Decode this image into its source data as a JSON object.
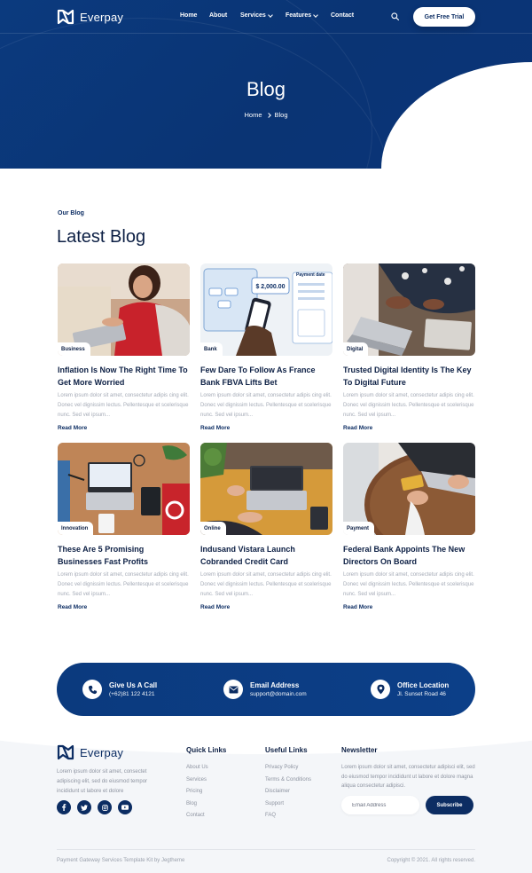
{
  "brand": {
    "name": "Everpay"
  },
  "nav": {
    "items": [
      {
        "label": "Home"
      },
      {
        "label": "About"
      },
      {
        "label": "Services"
      },
      {
        "label": "Features"
      },
      {
        "label": "Contact"
      }
    ],
    "cta_label": "Get Free Trial",
    "search_icon": "search-icon"
  },
  "hero": {
    "title": "Blog",
    "breadcrumb": [
      "Home",
      "Blog"
    ]
  },
  "blog": {
    "eyebrow": "Our Blog",
    "title": "Latest Blog",
    "posts": [
      {
        "category": "Business",
        "title": "Inflation Is Now The Right Time To Get More Worried",
        "excerpt": "Lorem ipsum dolor sit amet, consectetur adipis cing elit. Donec vel dignissim lectus. Pellentesque et scelerisque nunc. Sed vel ipsum...",
        "link": "Read More"
      },
      {
        "category": "Bank",
        "title": "Few Dare To Follow As France Bank FBVA Lifts Bet",
        "excerpt": "Lorem ipsum dolor sit amet, consectetur adipis cing elit. Donec vel dignissim lectus. Pellentesque et scelerisque nunc. Sed vel ipsum...",
        "link": "Read More"
      },
      {
        "category": "Digital",
        "title": "Trusted Digital Identity Is The Key To Digital Future",
        "excerpt": "Lorem ipsum dolor sit amet, consectetur adipis cing elit. Donec vel dignissim lectus. Pellentesque et scelerisque nunc. Sed vel ipsum...",
        "link": "Read More"
      },
      {
        "category": "Innovation",
        "title": "These Are 5 Promising Businesses Fast Profits",
        "excerpt": "Lorem ipsum dolor sit amet, consectetur adipis cing elit. Donec vel dignissim lectus. Pellentesque et scelerisque nunc. Sed vel ipsum...",
        "link": "Read More"
      },
      {
        "category": "Online",
        "title": "Indusand Vistara Launch Cobranded Credit Card",
        "excerpt": "Lorem ipsum dolor sit amet, consectetur adipis cing elit. Donec vel dignissim lectus. Pellentesque et scelerisque nunc. Sed vel ipsum...",
        "link": "Read More"
      },
      {
        "category": "Payment",
        "title": "Federal Bank Appoints The New Directors On Board",
        "excerpt": "Lorem ipsum dolor sit amet, consectetur adipis cing elit. Donec vel dignissim lectus. Pellentesque et scelerisque nunc. Sed vel ipsum...",
        "link": "Read More"
      }
    ]
  },
  "contact_bar": [
    {
      "icon": "phone-icon",
      "title": "Give Us A Call",
      "value": "(+62)81 122 4121"
    },
    {
      "icon": "envelope-icon",
      "title": "Email Address",
      "value": "support@domain.com"
    },
    {
      "icon": "map-pin-icon",
      "title": "Office Location",
      "value": "Jl. Sunset Road 46"
    }
  ],
  "footer": {
    "about": "Lorem ipsum dolor sit amet, consectet adipiscing elit, sed do eiusmod tempor incididunt ut labore et dolore",
    "socials": [
      "facebook-icon",
      "twitter-icon",
      "instagram-icon",
      "youtube-icon"
    ],
    "quick_links": {
      "title": "Quick Links",
      "items": [
        "About Us",
        "Services",
        "Pricing",
        "Blog",
        "Contact"
      ]
    },
    "useful_links": {
      "title": "Useful Links",
      "items": [
        "Privacy Policy",
        "Terms & Conditions",
        "Disclaimer",
        "Support",
        "FAQ"
      ]
    },
    "newsletter": {
      "title": "Newsletter",
      "text": "Lorem ipsum dolor sit amet, consectetur adipisci elit, sed do eiusmod tempor incididunt ut labore et dolore magna aliqua consectetur adipisci.",
      "placeholder": "Email Address",
      "button": "Subscribe"
    },
    "credit": "Payment Gateway Services Template Kit by Jegtheme",
    "copyright": "Copyright © 2021. All rights reserved."
  },
  "colors": {
    "primary": "#0c2d63",
    "hero": "#0b3a7e",
    "muted": "#8d93a0"
  }
}
